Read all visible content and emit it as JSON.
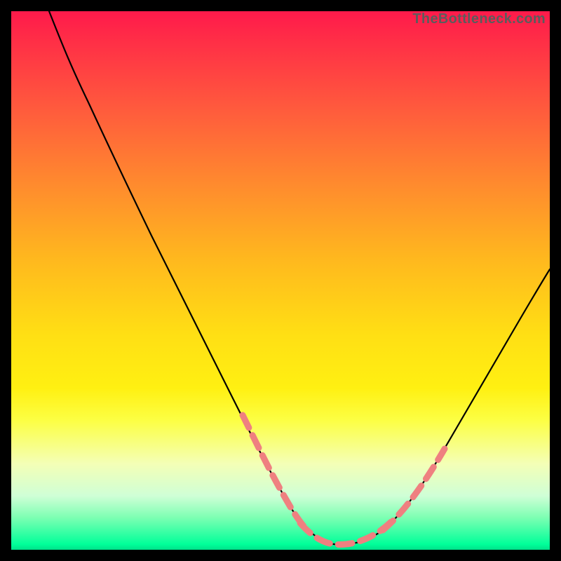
{
  "watermark": {
    "text": "TheBottleneck.com"
  },
  "colors": {
    "frame_bg": "#000000",
    "curve_stroke": "#000000",
    "dash_stroke": "#ef8080",
    "gradient_top": "#ff1a4b",
    "gradient_bottom": "#00e08a"
  },
  "chart_data": {
    "type": "line",
    "title": "",
    "xlabel": "",
    "ylabel": "",
    "xlim": [
      0,
      100
    ],
    "ylim": [
      0,
      100
    ],
    "grid": false,
    "legend": false,
    "series": [
      {
        "name": "bottleneck-curve",
        "x": [
          7,
          10,
          14,
          18,
          22,
          26,
          30,
          34,
          38,
          42,
          46,
          50,
          53,
          56,
          59,
          62,
          65,
          68,
          72,
          76,
          80,
          84,
          88,
          92,
          96,
          100
        ],
        "y": [
          100,
          96,
          90,
          83,
          75,
          66,
          57,
          48,
          39,
          30,
          22,
          14,
          9,
          5,
          2,
          1,
          1,
          2,
          5,
          10,
          17,
          25,
          33,
          41,
          49,
          56
        ]
      }
    ],
    "highlight_segments": [
      {
        "name": "left-dash",
        "x": [
          42,
          46,
          50,
          53
        ],
        "y": [
          30,
          22,
          14,
          9
        ]
      },
      {
        "name": "valley-dash",
        "x": [
          53,
          56,
          59,
          62,
          65,
          68
        ],
        "y": [
          9,
          5,
          2,
          1,
          1,
          2
        ]
      },
      {
        "name": "right-dash",
        "x": [
          68,
          72,
          76,
          80
        ],
        "y": [
          2,
          5,
          10,
          17
        ]
      }
    ]
  }
}
